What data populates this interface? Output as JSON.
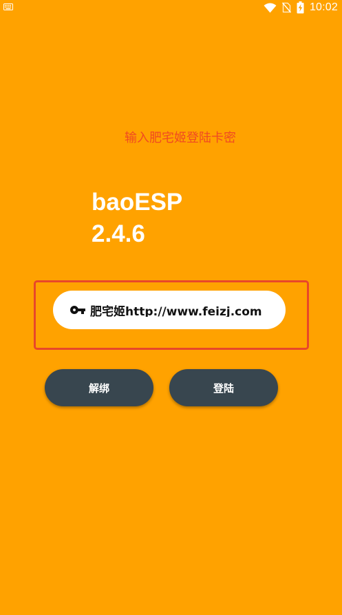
{
  "status_bar": {
    "time": "10:02",
    "icons": [
      "keyboard-icon",
      "wifi-icon",
      "no-sim-icon",
      "battery-charging-icon"
    ]
  },
  "colors": {
    "background": "#FFA200",
    "prompt_text": "#F04A22",
    "highlight_border": "#E8472A",
    "button_bg": "#38464F",
    "field_bg": "#FFFFFF"
  },
  "login": {
    "prompt": "输入肥宅姬登陆卡密",
    "app_name": "baoESP",
    "app_version": "2.4.6",
    "key_field": {
      "icon": "key-icon",
      "value": "肥宅姬http://www.feizj.com",
      "placeholder": ""
    },
    "unbind_label": "解绑",
    "login_label": "登陆"
  }
}
